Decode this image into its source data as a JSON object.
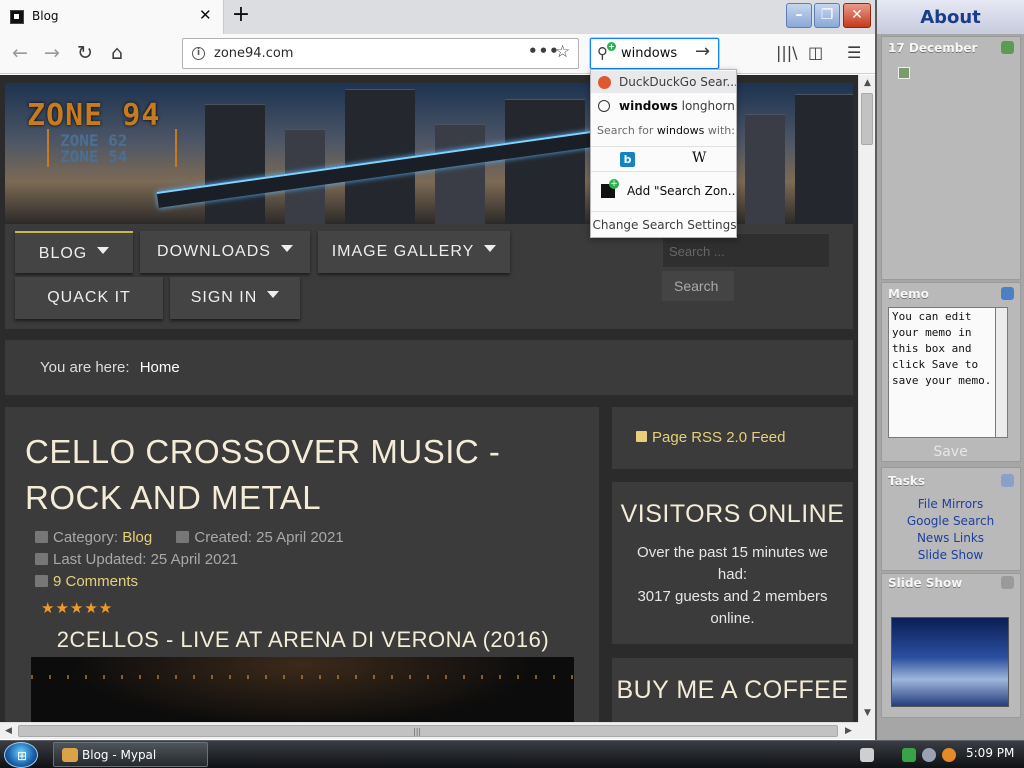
{
  "browser": {
    "tab_title": "Blog",
    "url": "zone94.com",
    "search_query": "windows"
  },
  "search_popup": {
    "suggestion_1": "DuckDuckGo Sear...",
    "suggestion_2_bold": "windows",
    "suggestion_2_rest": " longhorn",
    "search_for_prefix": "Search for ",
    "search_for_query": "windows",
    "search_for_suffix": " with:",
    "wiki_label": "W",
    "bing_label": "b",
    "add_engine": "Add \"Search Zon...",
    "change_settings": "Change Search Settings"
  },
  "site": {
    "logo_main": "ZONE 94",
    "logo_sub_1": "ZONE 62",
    "logo_sub_2": "ZONE 54",
    "menu": [
      "BLOG",
      "DOWNLOADS",
      "IMAGE GALLERY",
      "QUACK IT",
      "SIGN IN"
    ],
    "search_placeholder": "Search ...",
    "search_button": "Search",
    "breadcrumb_prefix": "You are here:",
    "breadcrumb_home": "Home"
  },
  "article": {
    "title": "CELLO CROSSOVER MUSIC - ROCK AND METAL",
    "category_label": "Category:",
    "category_value": "Blog",
    "created": "Created: 25 April 2021",
    "updated": "Last Updated: 25 April 2021",
    "comments": "9 Comments",
    "rating": 5,
    "stars": "★★★★★",
    "video_title": "2CELLOS - LIVE AT ARENA DI VERONA (2016)"
  },
  "sidebar_site": {
    "rss": "Page RSS 2.0 Feed",
    "visitors_title": "VISITORS ONLINE",
    "visitors_text": "Over the past 15 minutes we had:",
    "visitors_count": "3017 guests and 2 members online.",
    "coffee_title": "BUY ME A COFFEE"
  },
  "win_sidebar": {
    "title": "About",
    "date": "17 December",
    "memo_title": "Memo",
    "memo_text": "You can edit your memo in this box and click Save to save your memo.",
    "memo_save": "Save",
    "tasks_title": "Tasks",
    "tasks": [
      "File Mirrors",
      "Google Search",
      "News Links",
      "Slide Show"
    ],
    "slideshow_title": "Slide Show"
  },
  "taskbar": {
    "window_label": "Blog - Mypal",
    "clock": "5:09 PM"
  },
  "colors": {
    "accent_link": "#e6d07a",
    "page_bg": "#2b2b2b",
    "panel_bg": "#3b3b3b",
    "star": "#ee9a2a"
  }
}
